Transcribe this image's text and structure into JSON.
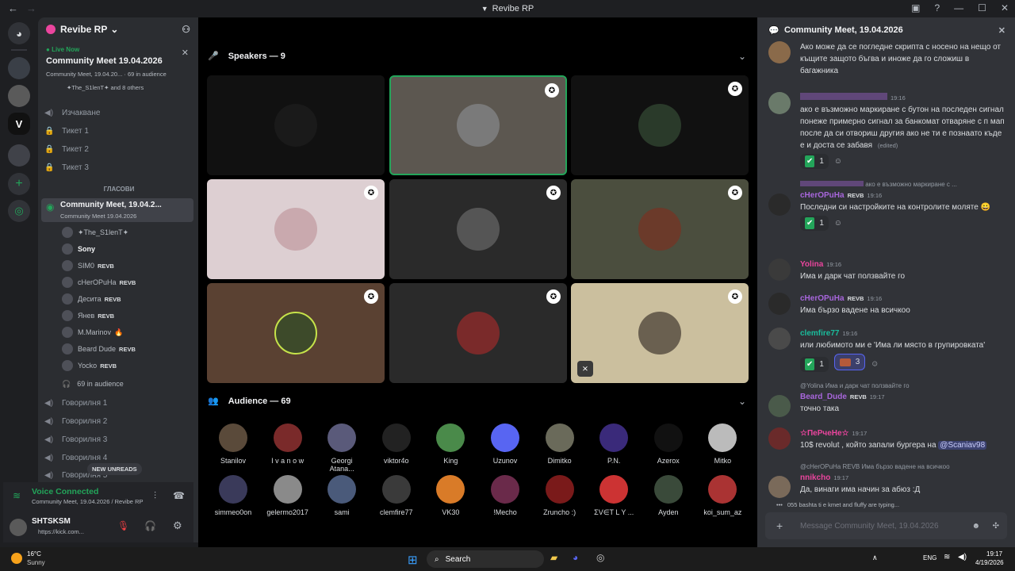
{
  "window": {
    "title": "Revibe RP"
  },
  "server": {
    "name": "Revibe RP"
  },
  "live": {
    "tag": "Live Now",
    "title": "Community Meet 19.04.2026",
    "sub": "Community Meet, 19.04.20... · 69 in audience",
    "others": "✦The_S1lenT✦ and 8 others"
  },
  "channels": [
    {
      "icon": "speaker",
      "label": "Изчакване"
    },
    {
      "icon": "lock",
      "label": "Тикет 1"
    },
    {
      "icon": "lock",
      "label": "Тикет 2"
    },
    {
      "icon": "lock",
      "label": "Тикет 3"
    }
  ],
  "category": "ГЛАСОВИ",
  "active_channel": {
    "label": "Community Meet, 19.04.2...",
    "sub": "Community Meet 19.04.2026"
  },
  "members": [
    {
      "name": "✦The_S1lenT✦",
      "badge": ""
    },
    {
      "name": "Sony",
      "badge": ""
    },
    {
      "name": "SIM0",
      "badge": "REVB"
    },
    {
      "name": "cHerOPuHa",
      "badge": "REVB"
    },
    {
      "name": "Десита",
      "badge": "REVB"
    },
    {
      "name": "Янев",
      "badge": "REVB"
    },
    {
      "name": "M.Marinov",
      "badge": ""
    },
    {
      "name": "Beard Dude",
      "badge": "REVB"
    },
    {
      "name": "Yocko",
      "badge": "REVB"
    },
    {
      "name": "69 in audience",
      "badge": ""
    }
  ],
  "voice_channels": [
    "Говорилня 1",
    "Говорилня 2",
    "Говорилня 3",
    "Говорилня 4",
    "Говорилня 5"
  ],
  "new_unreads": "NEW UNREADS",
  "voice": {
    "title": "Voice Connected",
    "sub": "Community Meet, 19.04.2026 / Revibe RP"
  },
  "user": {
    "name": "SHTSKSM",
    "status": "https://kick.com..."
  },
  "stage": {
    "speakers_label": "Speakers — 9",
    "audience_label": "Audience — 69",
    "audience": [
      "Stanilov",
      "I v a n o w",
      "Georgi Atana...",
      "viktor4o",
      "King",
      "Uzunov",
      "Dimitko",
      "P.N.",
      "Azerox",
      "Mitko",
      "simmeo0on",
      "gelermo2017",
      "sami",
      "clemfire77",
      "VK30",
      "!Mecho",
      "Zruncho :)",
      "ΣV∈T L Y ...",
      "Ayden",
      "koi_sum_az"
    ]
  },
  "chat": {
    "title": "Community Meet, 19.04.2026",
    "messages": [
      {
        "text": "Ако може да се погледне скрипта с носено на нещо от къщите защото бъгва и иноже да го сложиш в багажника"
      },
      {
        "user": "",
        "time": "19:16",
        "text": "ако е възможно маркиране с бутон на последен сигнал понеже примерно сигнал за банкомат отваряне с п мап после да си отвориш другия ако не ти е познаато къде е и доста се забавя",
        "edited": "(edited)",
        "react": "1"
      },
      {
        "reply": "ако е възможно маркиране с ...",
        "user": "cHerOPuHa",
        "badge": "REVB",
        "time": "19:16",
        "text": "Последни си настройките на контролите моляте",
        "react": "1"
      },
      {
        "user": "Yolina",
        "time": "19:16",
        "text": "Има и дарк чат ползвайте го"
      },
      {
        "user": "cHerOPuHa",
        "badge": "REVB",
        "time": "19:16",
        "text": "Има бързо вадене на всичкоо"
      },
      {
        "user": "clemfire77",
        "time": "19:16",
        "text": "или любимото ми е 'Има ли място в групировката'",
        "react": "1",
        "react2": "3"
      },
      {
        "reply": "@Yolina Има и дарк чат ползвайте го",
        "user": "Beard_Dude",
        "badge": "REVB",
        "time": "19:17",
        "text": "точно така"
      },
      {
        "user": "☆ПеРчеНе☆",
        "time": "19:17",
        "text": "10$ revolut , който запали бургера на ",
        "mention": "@Scaniav98"
      },
      {
        "reply": "@cHerOPuHa REVB Има бързо вадене на всичкоо",
        "user": "nnikcho",
        "time": "19:17",
        "text": "Да, винаги има начин за абюз :Д"
      }
    ],
    "typing": "055 bashta ti e kmet and fluffy are typing...",
    "placeholder": "Message Community Meet, 19.04.2026"
  },
  "taskbar": {
    "temp": "16°C",
    "weather": "Sunny",
    "search": "Search",
    "lang": "ENG",
    "time": "19:17",
    "date": "4/19/2026"
  },
  "colors": {
    "green": "#23a55a",
    "mention": "#5865f2",
    "purple": "#a866dc",
    "pink": "#eb459e",
    "teal": "#1abc9c"
  }
}
